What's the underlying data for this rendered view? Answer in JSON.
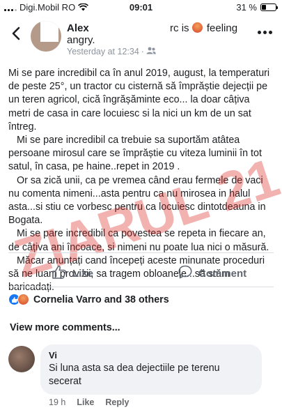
{
  "status_bar": {
    "carrier": "Digi.Mobil RO",
    "time": "09:01",
    "battery_text": "31 %",
    "battery_level": 0.31
  },
  "post": {
    "author": "Alex",
    "name_suffix": "rc is",
    "feeling_word": "feeling",
    "feeling": "angry.",
    "timestamp": "Yesterday at 12:34",
    "body": [
      "Mi se pare incredibil ca în anul 2019, august, la temperaturi de peste 25°, un tractor cu cisternă să împrăștie dejecții pe un teren agricol, cică îngrășăminte eco... la doar câțiva metri de casa in care locuiesc si la nici un km de un sat întreg.",
      "Mi se pare incredibil ca trebuie sa suportăm atâtea persoane mirosul care se împrăștie cu viteza luminii în tot satul, în casa, pe haine..repet in 2019 .",
      "Or sa zică unii, ca pe vremea când erau fermele de vaci nu comenta nimeni...asta pentru ca nu mirosea in halul asta...si stiu ce vorbesc pentru ca locuiesc dintotdeauna in Bogata.",
      "Mi se pare incredibil ca povestea se repeta in fiecare an, de câțiva ani încoace,  si nimeni nu poate lua nici o măsură.",
      "Măcar anunțați cand începeți aceste minunate proceduri să ne luam provizii, sa tragem obloanele...să stăm baricadați."
    ],
    "watermark": "ZIARUL 21"
  },
  "actions": {
    "like_label": "Like",
    "comment_label": "Comment"
  },
  "reactions": {
    "summary": "Cornelia Varro and 38 others"
  },
  "comments_section": {
    "view_more": "View more comments...",
    "comment": {
      "author_visible": "Vi",
      "text": "Si luna asta sa dea dejectiile pe terenu secerat",
      "age": "19 h",
      "like_label": "Like",
      "reply_label": "Reply"
    }
  },
  "colors": {
    "accent_like": "#1877f2",
    "muted_text": "#606770",
    "watermark": "#d7231e"
  }
}
